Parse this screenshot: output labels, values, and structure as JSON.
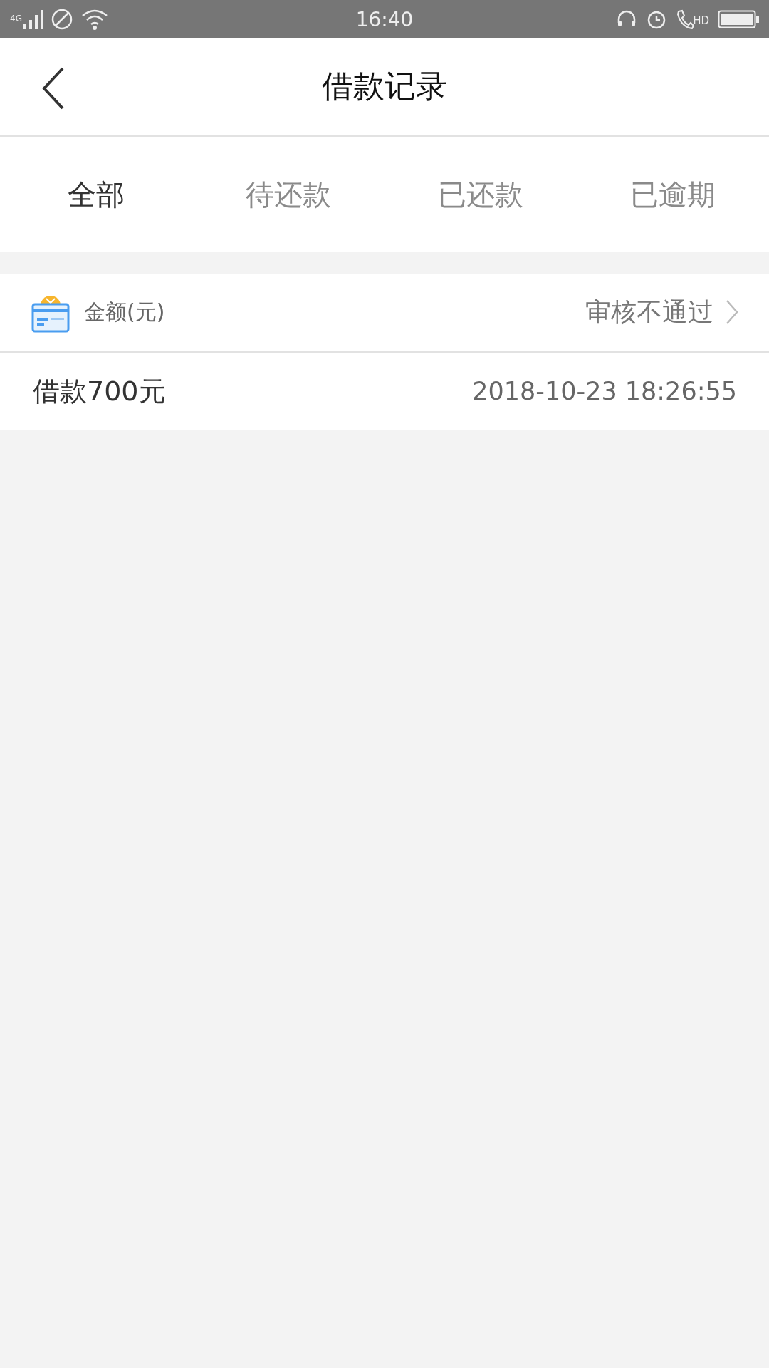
{
  "status_bar": {
    "network": "4G",
    "time": "16:40",
    "call_label": "HD"
  },
  "header": {
    "title": "借款记录"
  },
  "tabs": [
    {
      "label": "全部",
      "selected": true
    },
    {
      "label": "待还款",
      "selected": false
    },
    {
      "label": "已还款",
      "selected": false
    },
    {
      "label": "已逾期",
      "selected": false
    }
  ],
  "records": [
    {
      "amount_label": "金额(元)",
      "status": "审核不通过",
      "title": "借款700元",
      "time": "2018-10-23 18:26:55"
    }
  ]
}
